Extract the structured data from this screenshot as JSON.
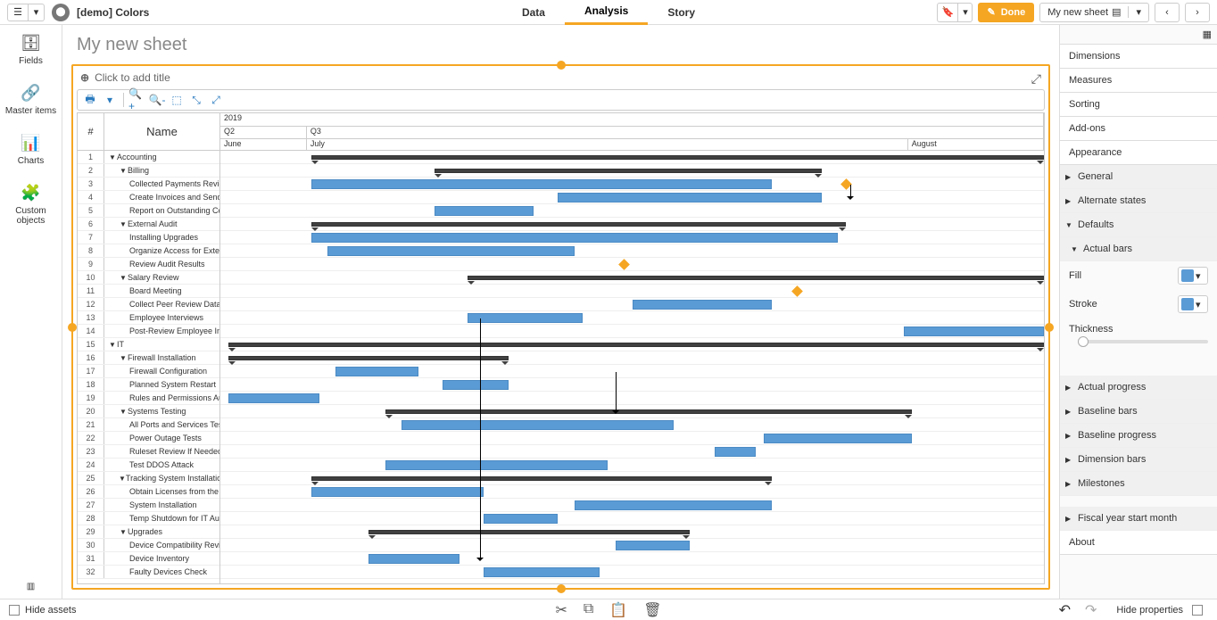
{
  "topbar": {
    "appTitle": "[demo] Colors",
    "tabs": {
      "data": "Data",
      "analysis": "Analysis",
      "story": "Story"
    },
    "done": "Done",
    "sheetName": "My new sheet"
  },
  "asset": {
    "fields": "Fields",
    "master": "Master items",
    "charts": "Charts",
    "custom": "Custom objects"
  },
  "sheet": {
    "title": "My new sheet",
    "addTitle": "Click to add title"
  },
  "gantt": {
    "header": {
      "hash": "#",
      "name": "Name",
      "year": "2019",
      "q2": "Q2",
      "q3": "Q3",
      "jun": "June",
      "jul": "July",
      "aug": "August"
    },
    "rows": [
      {
        "n": 1,
        "lvl": 0,
        "caret": true,
        "name": "Accounting",
        "type": "sum",
        "s": 11,
        "e": 100
      },
      {
        "n": 2,
        "lvl": 1,
        "caret": true,
        "name": "Billing",
        "type": "sum",
        "s": 26,
        "e": 73
      },
      {
        "n": 3,
        "lvl": 2,
        "name": "Collected Payments Review",
        "type": "bar",
        "s": 11,
        "e": 67,
        "ms": 76
      },
      {
        "n": 4,
        "lvl": 2,
        "name": "Create Invoices and Send I",
        "type": "bar",
        "s": 41,
        "e": 73
      },
      {
        "n": 5,
        "lvl": 2,
        "name": "Report on Outstanding Co",
        "type": "bar",
        "s": 26,
        "e": 38
      },
      {
        "n": 6,
        "lvl": 1,
        "caret": true,
        "name": "External Audit",
        "type": "sum",
        "s": 11,
        "e": 76
      },
      {
        "n": 7,
        "lvl": 2,
        "name": "Installing Upgrades",
        "type": "bar",
        "s": 11,
        "e": 75
      },
      {
        "n": 8,
        "lvl": 2,
        "name": "Organize Access for Extern",
        "type": "bar",
        "s": 13,
        "e": 43
      },
      {
        "n": 9,
        "lvl": 2,
        "name": "Review Audit Results",
        "type": "bar",
        "s": 0,
        "e": 0,
        "ms": 49
      },
      {
        "n": 10,
        "lvl": 1,
        "caret": true,
        "name": "Salary Review",
        "type": "sum",
        "s": 30,
        "e": 100
      },
      {
        "n": 11,
        "lvl": 2,
        "name": "Board Meeting",
        "type": "bar",
        "s": 0,
        "e": 0,
        "ms": 70
      },
      {
        "n": 12,
        "lvl": 2,
        "name": "Collect Peer Review Data",
        "type": "bar",
        "s": 50,
        "e": 67
      },
      {
        "n": 13,
        "lvl": 2,
        "name": "Employee Interviews",
        "type": "bar",
        "s": 30,
        "e": 44
      },
      {
        "n": 14,
        "lvl": 2,
        "name": "Post-Review Employee Int",
        "type": "bar",
        "s": 83,
        "e": 100
      },
      {
        "n": 15,
        "lvl": 0,
        "caret": true,
        "name": "IT",
        "type": "sum",
        "s": 1,
        "e": 100
      },
      {
        "n": 16,
        "lvl": 1,
        "caret": true,
        "name": "Firewall Installation",
        "type": "sum",
        "s": 1,
        "e": 35
      },
      {
        "n": 17,
        "lvl": 2,
        "name": "Firewall Configuration",
        "type": "bar",
        "s": 14,
        "e": 24
      },
      {
        "n": 18,
        "lvl": 2,
        "name": "Planned System Restart",
        "type": "bar",
        "s": 27,
        "e": 35
      },
      {
        "n": 19,
        "lvl": 2,
        "name": "Rules and Permissions Au",
        "type": "bar",
        "s": 1,
        "e": 12
      },
      {
        "n": 20,
        "lvl": 1,
        "caret": true,
        "name": "Systems Testing",
        "type": "sum",
        "s": 20,
        "e": 84
      },
      {
        "n": 21,
        "lvl": 2,
        "name": "All Ports and Services Test",
        "type": "bar",
        "s": 22,
        "e": 55
      },
      {
        "n": 22,
        "lvl": 2,
        "name": "Power Outage Tests",
        "type": "bar",
        "s": 66,
        "e": 84
      },
      {
        "n": 23,
        "lvl": 2,
        "name": "Ruleset Review If Needed",
        "type": "bar",
        "s": 60,
        "e": 65
      },
      {
        "n": 24,
        "lvl": 2,
        "name": "Test DDOS Attack",
        "type": "bar",
        "s": 20,
        "e": 47
      },
      {
        "n": 25,
        "lvl": 1,
        "caret": true,
        "name": "Tracking System Installation",
        "type": "sum",
        "s": 11,
        "e": 67
      },
      {
        "n": 26,
        "lvl": 2,
        "name": "Obtain Licenses from the V",
        "type": "bar",
        "s": 11,
        "e": 32
      },
      {
        "n": 27,
        "lvl": 2,
        "name": "System Installation",
        "type": "bar",
        "s": 43,
        "e": 67
      },
      {
        "n": 28,
        "lvl": 2,
        "name": "Temp Shutdown for IT Aud",
        "type": "bar",
        "s": 32,
        "e": 41
      },
      {
        "n": 29,
        "lvl": 1,
        "caret": true,
        "name": "Upgrades",
        "type": "sum",
        "s": 18,
        "e": 57
      },
      {
        "n": 30,
        "lvl": 2,
        "name": "Device Compatibility Revi",
        "type": "bar",
        "s": 48,
        "e": 57
      },
      {
        "n": 31,
        "lvl": 2,
        "name": "Device Inventory",
        "type": "bar",
        "s": 18,
        "e": 29
      },
      {
        "n": 32,
        "lvl": 2,
        "name": "Faulty Devices Check",
        "type": "bar",
        "s": 32,
        "e": 46
      }
    ]
  },
  "props": {
    "sections": {
      "dimensions": "Dimensions",
      "measures": "Measures",
      "sorting": "Sorting",
      "addons": "Add-ons",
      "appearance": "Appearance",
      "about": "About"
    },
    "subs": {
      "general": "General",
      "altStates": "Alternate states",
      "defaults": "Defaults",
      "actualBars": "Actual bars",
      "actualProgress": "Actual progress",
      "baselineBars": "Baseline bars",
      "baselineProgress": "Baseline progress",
      "dimensionBars": "Dimension bars",
      "milestones": "Milestones",
      "fiscalYear": "Fiscal year start month"
    },
    "fill": "Fill",
    "stroke": "Stroke",
    "thickness": "Thickness"
  },
  "status": {
    "hideAssets": "Hide assets",
    "hideProps": "Hide properties"
  }
}
